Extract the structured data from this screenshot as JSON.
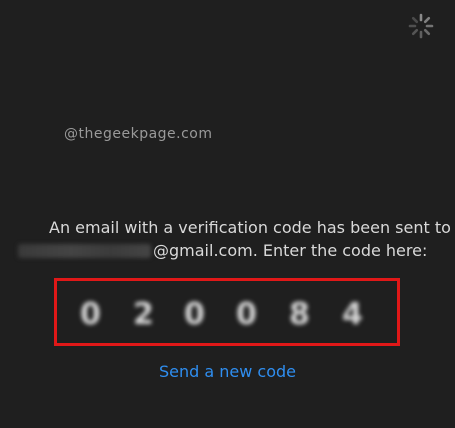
{
  "watermark": "@thegeekpage.com",
  "message": {
    "line1": "An email with a verification code has been sent to",
    "line2_suffix": "@gmail.com. Enter the code here:"
  },
  "code": {
    "digits": [
      "0",
      "2",
      "0",
      "0",
      "8",
      "4"
    ]
  },
  "resend_label": "Send a new code",
  "colors": {
    "background": "#1f1f1f",
    "highlight_border": "#e01818",
    "link": "#2f8ef0"
  },
  "icons": {
    "loading": "loading-spinner-icon"
  }
}
